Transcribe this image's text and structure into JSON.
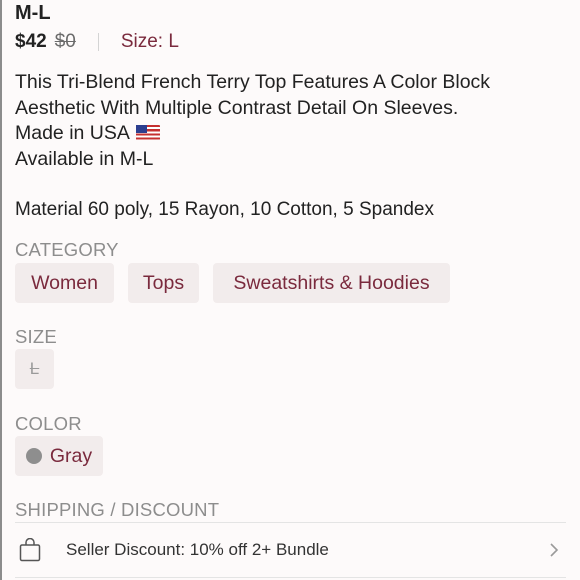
{
  "listing": {
    "title": "M-L",
    "price": "$42",
    "original_price": "$0",
    "size_label": "Size: L",
    "description_lines": [
      "This Tri-Blend French Terry Top Features A Color Block",
      "Aesthetic With Multiple Contrast Detail On Sleeves.",
      "Made in USA",
      "Available in M-L"
    ],
    "flag_icon": "us-flag-icon",
    "material": "Material 60 poly, 15 Rayon, 10 Cotton, 5 Spandex"
  },
  "category": {
    "heading": "CATEGORY",
    "items": [
      "Women",
      "Tops",
      "Sweatshirts & Hoodies"
    ]
  },
  "size": {
    "heading": "SIZE",
    "value": "L"
  },
  "color": {
    "heading": "COLOR",
    "value": "Gray",
    "swatch": "#8e8e8e"
  },
  "shipping": {
    "heading": "SHIPPING / DISCOUNT",
    "discount_text": "Seller Discount: 10% off 2+ Bundle",
    "icon": "shopping-bag-icon",
    "chevron_icon": "chevron-right-icon"
  },
  "colors": {
    "accent": "#7a2a3d",
    "chip_bg": "#f2ecec",
    "muted": "#8d8d8d"
  }
}
